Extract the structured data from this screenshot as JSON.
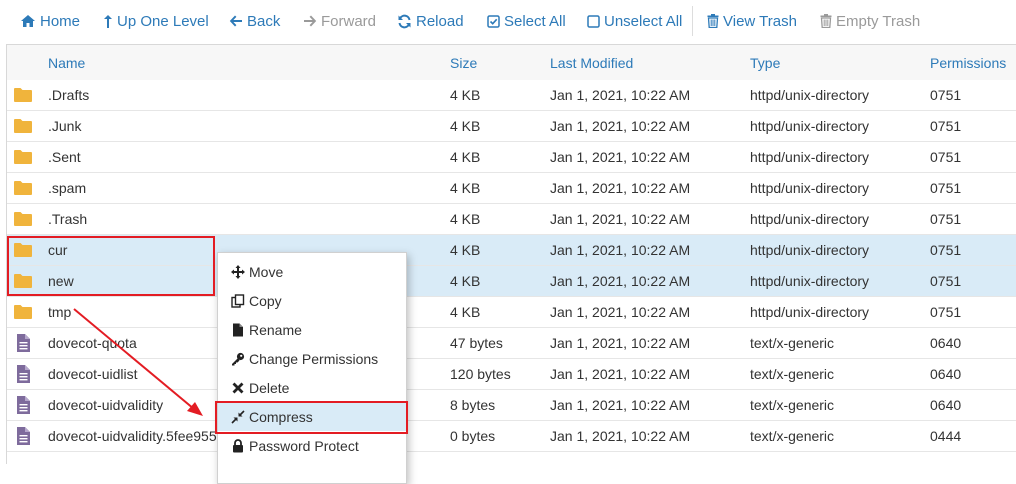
{
  "toolbar": {
    "home": "Home",
    "up": "Up One Level",
    "back": "Back",
    "forward": "Forward",
    "reload": "Reload",
    "select_all": "Select All",
    "unselect_all": "Unselect All",
    "view_trash": "View Trash",
    "empty_trash": "Empty Trash"
  },
  "columns": {
    "name": "Name",
    "size": "Size",
    "modified": "Last Modified",
    "type": "Type",
    "permissions": "Permissions"
  },
  "rows": [
    {
      "name": ".Drafts",
      "size": "4 KB",
      "modified": "Jan 1, 2021, 10:22 AM",
      "type": "httpd/unix-directory",
      "perm": "0751",
      "icon": "folder-icon",
      "selected": false
    },
    {
      "name": ".Junk",
      "size": "4 KB",
      "modified": "Jan 1, 2021, 10:22 AM",
      "type": "httpd/unix-directory",
      "perm": "0751",
      "icon": "folder-icon",
      "selected": false
    },
    {
      "name": ".Sent",
      "size": "4 KB",
      "modified": "Jan 1, 2021, 10:22 AM",
      "type": "httpd/unix-directory",
      "perm": "0751",
      "icon": "folder-icon",
      "selected": false
    },
    {
      "name": ".spam",
      "size": "4 KB",
      "modified": "Jan 1, 2021, 10:22 AM",
      "type": "httpd/unix-directory",
      "perm": "0751",
      "icon": "folder-icon",
      "selected": false
    },
    {
      "name": ".Trash",
      "size": "4 KB",
      "modified": "Jan 1, 2021, 10:22 AM",
      "type": "httpd/unix-directory",
      "perm": "0751",
      "icon": "folder-icon",
      "selected": false
    },
    {
      "name": "cur",
      "size": "4 KB",
      "modified": "Jan 1, 2021, 10:22 AM",
      "type": "httpd/unix-directory",
      "perm": "0751",
      "icon": "folder-icon",
      "selected": true
    },
    {
      "name": "new",
      "size": "4 KB",
      "modified": "Jan 1, 2021, 10:22 AM",
      "type": "httpd/unix-directory",
      "perm": "0751",
      "icon": "folder-icon",
      "selected": true
    },
    {
      "name": "tmp",
      "size": "4 KB",
      "modified": "Jan 1, 2021, 10:22 AM",
      "type": "httpd/unix-directory",
      "perm": "0751",
      "icon": "folder-icon",
      "selected": false
    },
    {
      "name": "dovecot-quota",
      "size": "47 bytes",
      "modified": "Jan 1, 2021, 10:22 AM",
      "type": "text/x-generic",
      "perm": "0640",
      "icon": "file-icon",
      "selected": false
    },
    {
      "name": "dovecot-uidlist",
      "size": "120 bytes",
      "modified": "Jan 1, 2021, 10:22 AM",
      "type": "text/x-generic",
      "perm": "0640",
      "icon": "file-icon",
      "selected": false
    },
    {
      "name": "dovecot-uidvalidity",
      "size": "8 bytes",
      "modified": "Jan 1, 2021, 10:22 AM",
      "type": "text/x-generic",
      "perm": "0640",
      "icon": "file-icon",
      "selected": false
    },
    {
      "name": "dovecot-uidvalidity.5fee955",
      "size": "0 bytes",
      "modified": "Jan 1, 2021, 10:22 AM",
      "type": "text/x-generic",
      "perm": "0444",
      "icon": "file-icon",
      "selected": false
    }
  ],
  "context_menu": {
    "items": [
      {
        "label": "Move",
        "icon": "move-icon"
      },
      {
        "label": "Copy",
        "icon": "copy-icon"
      },
      {
        "label": "Rename",
        "icon": "rename-icon"
      },
      {
        "label": "Change Permissions",
        "icon": "key-icon"
      },
      {
        "label": "Delete",
        "icon": "delete-icon"
      },
      {
        "label": "Compress",
        "icon": "compress-icon",
        "highlighted": true
      },
      {
        "label": "Password Protect",
        "icon": "lock-icon"
      }
    ]
  },
  "colors": {
    "link": "#2d7ab8",
    "disabled": "#9a9a9a",
    "folder": "#f0b43c",
    "file": "#7e6b9c",
    "selected_row": "#d9ebf7",
    "annotation": "#e31c23"
  }
}
